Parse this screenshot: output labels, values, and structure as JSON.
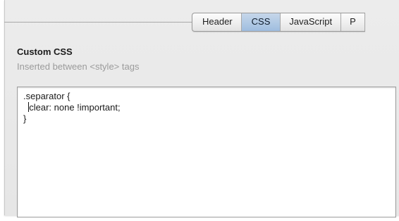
{
  "tabs": {
    "items": [
      {
        "label": "Header",
        "selected": false
      },
      {
        "label": "CSS",
        "selected": true
      },
      {
        "label": "JavaScript",
        "selected": false
      },
      {
        "label": "P",
        "selected": false
      }
    ]
  },
  "section": {
    "title": "Custom CSS",
    "subtitle": "Inserted between <style> tags"
  },
  "editor": {
    "lines": [
      ".separator {",
      "clear: none !important;",
      "}"
    ],
    "line2_indent": "  "
  },
  "colors": {
    "selected_tab": "#9fbddf",
    "pane_bg": "#ececec"
  }
}
